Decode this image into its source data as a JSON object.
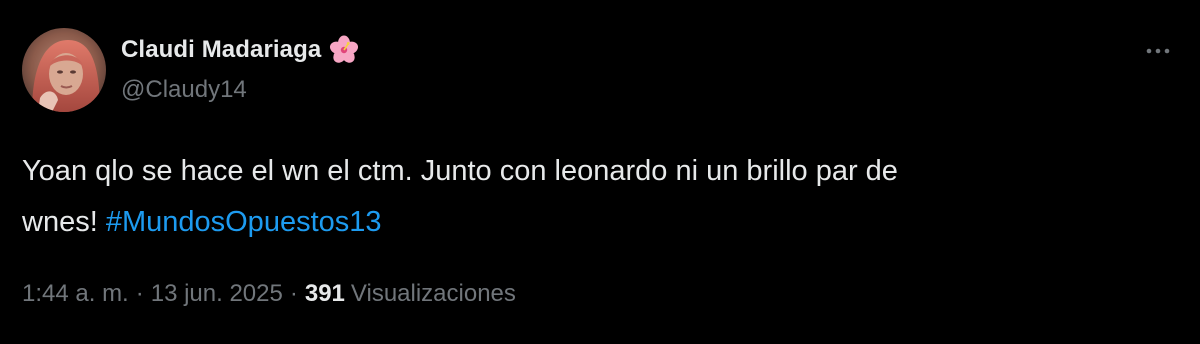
{
  "author": {
    "name": "Claudi Madariaga",
    "handle": "@Claudy14",
    "name_emoji_icon": "hibiscus-flower-icon"
  },
  "tweet": {
    "text_line_1": "Yoan qlo se hace el wn el ctm. Junto con leonardo ni un brillo par de",
    "text_line_2_prefix": "wnes! ",
    "hashtag": "#MundosOpuestos13"
  },
  "meta": {
    "time": "1:44 a. m.",
    "separator": "·",
    "date": "13 jun. 2025",
    "views_count": "391",
    "views_label": "Visualizaciones"
  },
  "icons": {
    "more": "more-horizontal-icon"
  },
  "colors": {
    "background": "#000000",
    "primary_text": "#e7e9ea",
    "secondary_text": "#71767b",
    "link": "#1d9bf0"
  }
}
